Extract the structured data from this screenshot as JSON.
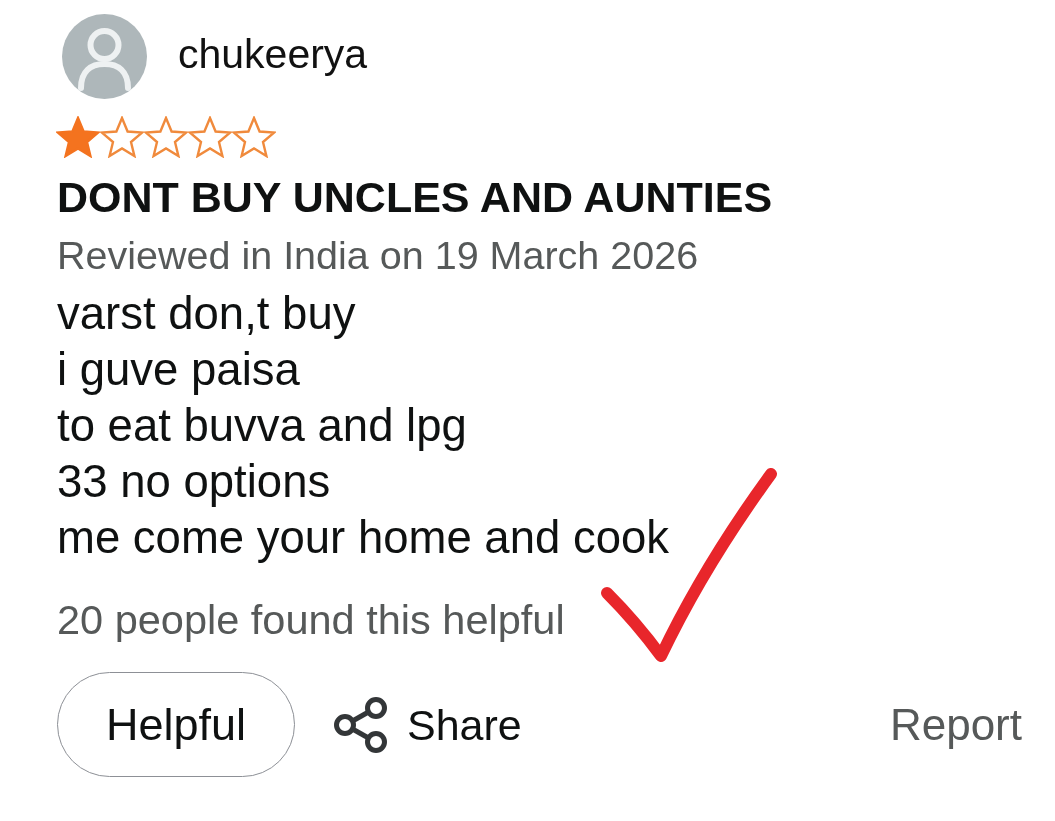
{
  "review": {
    "reviewer": {
      "name": "chukeerya"
    },
    "stars": 1,
    "title": "DONT BUY UNCLES AND AUNTIES",
    "meta": "Reviewed in India on 19 March 2026",
    "body_lines": [
      "varst don,t buy",
      "i guve paisa",
      "to eat buvva and lpg",
      "33 no options",
      "me come your home and cook"
    ],
    "helpful_count": "20 people found this helpful",
    "actions": [
      {
        "kind": "pill",
        "label": "Helpful"
      },
      {
        "kind": "share",
        "label": "Share"
      },
      {
        "kind": "link",
        "label": "Report"
      }
    ]
  }
}
